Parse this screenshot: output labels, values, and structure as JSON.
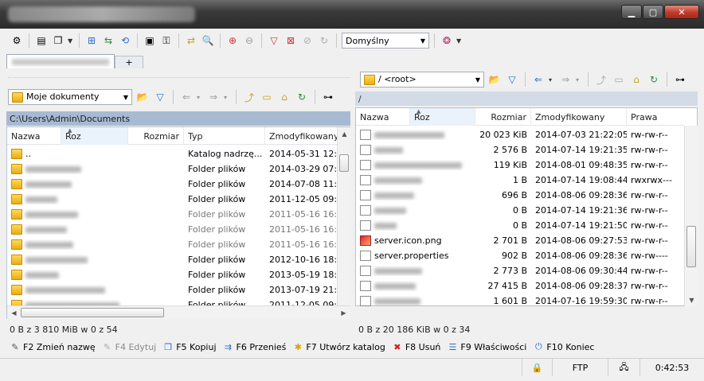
{
  "window": {
    "minimize": "▁",
    "maximize": "▢",
    "close": "✕"
  },
  "toolbar": {
    "profile_combo": "Domyślny"
  },
  "left": {
    "location": "Moje dokumenty",
    "path": "C:\\Users\\Admin\\Documents",
    "columns": {
      "name": "Nazwa",
      "ext": "Roz",
      "size": "Rozmiar",
      "type": "Typ",
      "modified": "Zmodyfikowany"
    },
    "rows": [
      {
        "name": "..",
        "type": "Katalog nadrzę...",
        "modified": "2014-05-31  12:5"
      },
      {
        "type": "Folder plików",
        "modified": "2014-03-29  07:3"
      },
      {
        "type": "Folder plików",
        "modified": "2014-07-08  11:1"
      },
      {
        "type": "Folder plików",
        "modified": "2011-12-05  09:2"
      },
      {
        "type": "Folder plików",
        "modified": "2011-05-16  16:2"
      },
      {
        "type": "Folder plików",
        "modified": "2011-05-16  16:2"
      },
      {
        "type": "Folder plików",
        "modified": "2011-05-16  16:2"
      },
      {
        "type": "Folder plików",
        "modified": "2012-10-16  18:3"
      },
      {
        "type": "Folder plików",
        "modified": "2013-05-19  18:3"
      },
      {
        "type": "Folder plików",
        "modified": "2013-07-19  21:0"
      },
      {
        "type": "Folder plików",
        "modified": "2011-12-05  09:1"
      }
    ],
    "status": "0 B z 3 810 MiB w 0 z 54"
  },
  "right": {
    "location": "/ <root>",
    "path": "/",
    "columns": {
      "name": "Nazwa",
      "ext": "Roz",
      "size": "Rozmiar",
      "modified": "Zmodyfikowany",
      "perms": "Prawa"
    },
    "rows": [
      {
        "name": "",
        "size": "20 023 KiB",
        "modified": "2014-07-03 21:22:05",
        "perms": "rw-rw-r--"
      },
      {
        "name": "",
        "size": "2 576 B",
        "modified": "2014-07-14 19:21:35",
        "perms": "rw-rw-r--"
      },
      {
        "name": "",
        "size": "119 KiB",
        "modified": "2014-08-01 09:48:35",
        "perms": "rw-rw-r--"
      },
      {
        "name": "",
        "size": "1 B",
        "modified": "2014-07-14 19:08:44",
        "perms": "rwxrwx---"
      },
      {
        "name": "",
        "size": "696 B",
        "modified": "2014-08-06 09:28:36",
        "perms": "rw-rw-r--"
      },
      {
        "name": "",
        "size": "0 B",
        "modified": "2014-07-14 19:21:36",
        "perms": "rw-rw-r--"
      },
      {
        "name": "",
        "size": "0 B",
        "modified": "2014-07-14 19:21:50",
        "perms": "rw-rw-r--"
      },
      {
        "name": "server.icon.png",
        "size": "2 701 B",
        "modified": "2014-08-06 09:27:53",
        "perms": "rw-rw-r--"
      },
      {
        "name": "server.properties",
        "size": "902 B",
        "modified": "2014-08-06 09:28:36",
        "perms": "rw-rw----"
      },
      {
        "name": "",
        "size": "2 773 B",
        "modified": "2014-08-06 09:30:44",
        "perms": "rw-rw-r--"
      },
      {
        "name": "",
        "size": "27 415 B",
        "modified": "2014-08-06 09:28:37",
        "perms": "rw-rw-r--"
      },
      {
        "name": "",
        "size": "1 601 B",
        "modified": "2014-07-16 19:59:30",
        "perms": "rw-rw-r--"
      }
    ],
    "status": "0 B z 20 186 KiB w 0 z 34"
  },
  "fkeys": [
    {
      "label": "F2 Zmień nazwę",
      "icon": "rename-icon",
      "disabled": false
    },
    {
      "label": "F4 Edytuj",
      "icon": "edit-icon",
      "disabled": true
    },
    {
      "label": "F5 Kopiuj",
      "icon": "copy-icon",
      "disabled": false
    },
    {
      "label": "F6 Przenieś",
      "icon": "move-icon",
      "disabled": false
    },
    {
      "label": "F7 Utwórz katalog",
      "icon": "new-folder-icon",
      "disabled": false
    },
    {
      "label": "F8 Usuń",
      "icon": "delete-icon",
      "disabled": false
    },
    {
      "label": "F9 Właściwości",
      "icon": "properties-icon",
      "disabled": false
    },
    {
      "label": "F10 Koniec",
      "icon": "exit-icon",
      "disabled": false
    }
  ],
  "bottom": {
    "protocol": "FTP",
    "time": "0:42:53"
  },
  "new_tab": "+"
}
